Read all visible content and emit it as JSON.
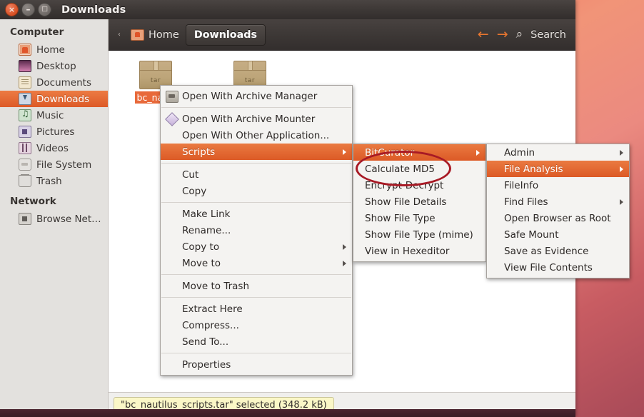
{
  "window": {
    "title": "Downloads",
    "controls": [
      {
        "name": "close",
        "glyph": "×"
      },
      {
        "name": "minimize",
        "glyph": "–"
      },
      {
        "name": "maximize",
        "glyph": "□"
      }
    ]
  },
  "sidebar": {
    "sections": [
      {
        "heading": "Computer",
        "items": [
          {
            "label": "Home",
            "icon": "home-icon",
            "active": false
          },
          {
            "label": "Desktop",
            "icon": "desktop-icon",
            "active": false
          },
          {
            "label": "Documents",
            "icon": "documents-icon",
            "active": false
          },
          {
            "label": "Downloads",
            "icon": "downloads-icon",
            "active": true
          },
          {
            "label": "Music",
            "icon": "music-icon",
            "active": false
          },
          {
            "label": "Pictures",
            "icon": "pictures-icon",
            "active": false
          },
          {
            "label": "Videos",
            "icon": "videos-icon",
            "active": false
          },
          {
            "label": "File System",
            "icon": "filesystem-icon",
            "active": false
          },
          {
            "label": "Trash",
            "icon": "trash-icon",
            "active": false
          }
        ]
      },
      {
        "heading": "Network",
        "items": [
          {
            "label": "Browse Net…",
            "icon": "network-icon",
            "active": false
          }
        ]
      }
    ]
  },
  "toolbar": {
    "separator": "‹",
    "breadcrumb_home": "Home",
    "breadcrumb_current": "Downloads",
    "back_arrow": "←",
    "forward_arrow": "→",
    "search_icon": "⌕",
    "search_label": "Search"
  },
  "files": [
    {
      "name": "bc_nauti",
      "type_label": "tar",
      "selected": true
    },
    {
      "name": "",
      "type_label": "tar",
      "selected": false
    }
  ],
  "statusbar": {
    "text": "\"bc_nautilus_scripts.tar\" selected (348.2 kB)"
  },
  "context_menu": {
    "items": [
      {
        "label": "Open With Archive Manager",
        "icon": "archive-manager-icon",
        "highlighted": false,
        "submenu": false
      },
      {
        "separator": true
      },
      {
        "label": "Open With Archive Mounter",
        "icon": "archive-mounter-icon",
        "highlighted": false,
        "submenu": false
      },
      {
        "label": "Open With Other Application...",
        "icon": null,
        "highlighted": false,
        "submenu": false
      },
      {
        "label": "Scripts",
        "icon": null,
        "highlighted": true,
        "submenu": true
      },
      {
        "separator": true
      },
      {
        "label": "Cut",
        "icon": null,
        "highlighted": false,
        "submenu": false
      },
      {
        "label": "Copy",
        "icon": null,
        "highlighted": false,
        "submenu": false
      },
      {
        "separator": true
      },
      {
        "label": "Make Link",
        "icon": null,
        "highlighted": false,
        "submenu": false
      },
      {
        "label": "Rename...",
        "icon": null,
        "highlighted": false,
        "submenu": false
      },
      {
        "label": "Copy to",
        "icon": null,
        "highlighted": false,
        "submenu": true
      },
      {
        "label": "Move to",
        "icon": null,
        "highlighted": false,
        "submenu": true
      },
      {
        "separator": true
      },
      {
        "label": "Move to Trash",
        "icon": null,
        "highlighted": false,
        "submenu": false
      },
      {
        "separator": true
      },
      {
        "label": "Extract Here",
        "icon": null,
        "highlighted": false,
        "submenu": false
      },
      {
        "label": "Compress...",
        "icon": null,
        "highlighted": false,
        "submenu": false
      },
      {
        "label": "Send To...",
        "icon": null,
        "highlighted": false,
        "submenu": false
      },
      {
        "separator": true
      },
      {
        "label": "Properties",
        "icon": null,
        "highlighted": false,
        "submenu": false
      }
    ]
  },
  "scripts_submenu": {
    "items": [
      {
        "label": "BitCurator",
        "highlighted": true,
        "submenu": true
      },
      {
        "label": "Calculate MD5",
        "highlighted": false,
        "submenu": false
      },
      {
        "label": "Encrypt-Decrypt",
        "highlighted": false,
        "submenu": false
      },
      {
        "label": "Show File Details",
        "highlighted": false,
        "submenu": false
      },
      {
        "label": "Show File Type",
        "highlighted": false,
        "submenu": false
      },
      {
        "label": "Show File Type (mime)",
        "highlighted": false,
        "submenu": false
      },
      {
        "label": "View in Hexeditor",
        "highlighted": false,
        "submenu": false
      }
    ]
  },
  "bitcurator_submenu": {
    "items": [
      {
        "label": "Admin",
        "highlighted": false,
        "submenu": true
      },
      {
        "label": "File Analysis",
        "highlighted": true,
        "submenu": true
      },
      {
        "label": "FileInfo",
        "highlighted": false,
        "submenu": false
      },
      {
        "label": "Find Files",
        "highlighted": false,
        "submenu": true
      },
      {
        "label": "Open Browser as Root",
        "highlighted": false,
        "submenu": false
      },
      {
        "label": "Safe Mount",
        "highlighted": false,
        "submenu": false
      },
      {
        "label": "Save as Evidence",
        "highlighted": false,
        "submenu": false
      },
      {
        "label": "View File Contents",
        "highlighted": false,
        "submenu": false
      }
    ]
  },
  "annotation": {
    "shape": "ellipse",
    "color": "#a81a25",
    "target_label": "Calculate MD5"
  },
  "colors": {
    "accent_orange": "#dd5a27",
    "titlebar": "#3d3836",
    "sidebar_bg": "#e3e1de",
    "menu_bg": "#f4f3f1",
    "annotation_red": "#a81a25"
  }
}
